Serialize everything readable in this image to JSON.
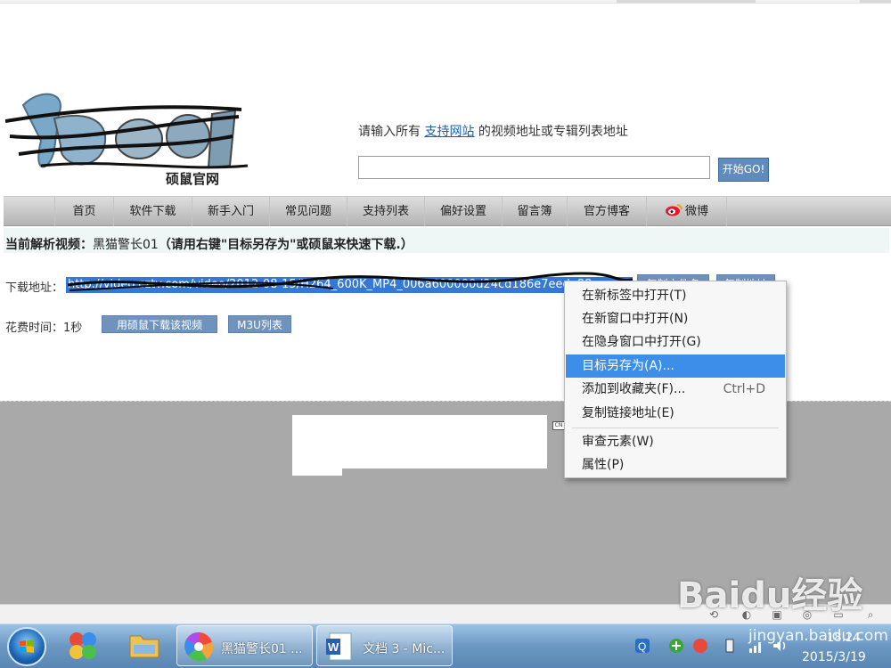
{
  "header": {
    "logo_caption": "硕鼠官网",
    "prompt_prefix": "请输入所有",
    "prompt_link": "支持网站",
    "prompt_suffix": "的视频地址或专辑列表地址",
    "url_input_value": "",
    "go_label": "开始GO!"
  },
  "nav": {
    "items": [
      {
        "label": "首页"
      },
      {
        "label": "软件下载"
      },
      {
        "label": "新手入门"
      },
      {
        "label": "常见问题"
      },
      {
        "label": "支持列表"
      },
      {
        "label": "偏好设置"
      },
      {
        "label": "留言簿"
      },
      {
        "label": "官方博客"
      },
      {
        "label": "微博"
      }
    ]
  },
  "parse": {
    "heading": "当前解析视频：",
    "video_title": "黑猫警长01",
    "hint": "（请用右键\"目标另存为\"或硕鼠来快速下载.）"
  },
  "download": {
    "label": "下载地址：",
    "url": "http://video.cztv.com/video/2012-08-15/H264_600K_MP4_006a600000d24cd186e7eede88",
    "copy_name_label": "复制文件名",
    "copy_url_label": "复制地址"
  },
  "timing": {
    "label": "花费时间：1秒",
    "shuoshu_btn": "用硕鼠下载该视频",
    "m3u_btn": "M3U列表"
  },
  "context_menu": {
    "items": [
      {
        "label": "在新标签中打开(T)",
        "shortcut": ""
      },
      {
        "label": "在新窗口中打开(N)",
        "shortcut": ""
      },
      {
        "label": "在隐身窗口中打开(G)",
        "shortcut": ""
      },
      {
        "label": "目标另存为(A)...",
        "shortcut": ""
      },
      {
        "label": "添加到收藏夹(F)...",
        "shortcut": "Ctrl+D"
      },
      {
        "label": "复制链接地址(E)",
        "shortcut": ""
      },
      {
        "label": "审查元素(W)",
        "shortcut": ""
      },
      {
        "label": "属性(P)",
        "shortcut": ""
      }
    ],
    "highlighted_index": 3
  },
  "taskbar": {
    "apps": [
      {
        "label": "黑猫警长01 ..."
      },
      {
        "label": "文档 3 - Mic..."
      }
    ],
    "time": "18:24",
    "date": "2015/3/19"
  },
  "watermark": {
    "brand": "Baidu经验",
    "sub": "jingyan.baidu.com"
  },
  "colors": {
    "link_blue": "#1a5fb4",
    "menu_highlight": "#3d8ee8",
    "button_blue": "#6f93bd"
  }
}
